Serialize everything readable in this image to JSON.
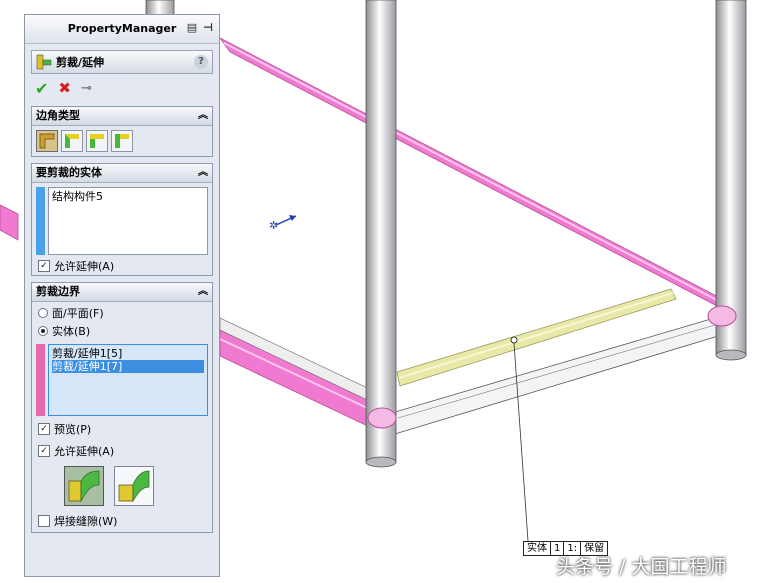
{
  "panel": {
    "title": "PropertyManager",
    "feature_name": "剪裁/延伸",
    "help_label": "?",
    "groups": {
      "corner_type": {
        "title": "边角类型"
      },
      "bodies_to_trim": {
        "title": "要剪裁的实体",
        "items": [
          "结构构件5"
        ],
        "allow_extension_label": "允许延伸(A)"
      },
      "trim_boundary": {
        "title": "剪裁边界",
        "option_face": "面/平面(F)",
        "option_body": "实体(B)",
        "items": [
          "剪裁/延伸1[5]",
          "剪裁/延伸1[7]"
        ],
        "preview_label": "预览(P)",
        "allow_extension_label": "允许延伸(A)",
        "weld_gap_label": "焊接缝隙(W)"
      }
    }
  },
  "tag": {
    "parts": [
      "实体",
      "1",
      "1:",
      "保留"
    ]
  },
  "watermark": "头条号 / 大国工程师",
  "colors": {
    "pink_tube": "#f07ad0",
    "yellow_tube": "#e8e8a8",
    "grey_tube": "#c9c9cf",
    "accent": "#3b8ee0",
    "body_bar": "#4aa1e8",
    "boundary_bar": "#e669ae"
  }
}
